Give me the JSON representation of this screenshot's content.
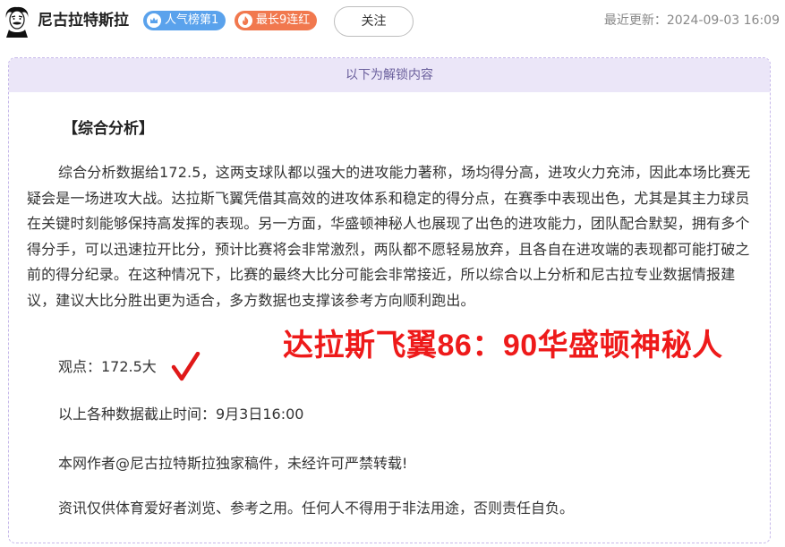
{
  "header": {
    "author_name": "尼古拉特斯拉",
    "avatar_icon": "einstein-portrait-avatar",
    "badges": [
      {
        "label": "人气榜第1",
        "icon": "crown-icon",
        "color": "#5aa2ec"
      },
      {
        "label": "最长9连红",
        "icon": "flame-icon",
        "color": "#f1784e"
      }
    ],
    "follow_label": "关注",
    "update_time": "最近更新：2024-09-03 16:09"
  },
  "card": {
    "banner": "以下为解锁内容",
    "section_title": "【综合分析】",
    "paragraph": "综合分析数据给172.5，这两支球队都以强大的进攻能力著称，场均得分高，进攻火力充沛，因此本场比赛无疑会是一场进攻大战。达拉斯飞翼凭借其高效的进攻体系和稳定的得分点，在赛季中表现出色，尤其是其主力球员在关键时刻能够保持高发挥的表现。另一方面，华盛顿神秘人也展现了出色的进攻能力，团队配合默契，拥有多个得分手，可以迅速拉开比分，预计比赛将会非常激烈，两队都不愿轻易放弃，且各自在进攻端的表现都可能打破之前的得分纪录。在这种情况下，比赛的最终大比分可能会非常接近，所以综合以上分析和尼古拉专业数据情报建议，建议大比分胜出更为适合，多方数据也支撑该参考方向顺利跑出。",
    "viewpoint": "观点：172.5大",
    "viewpoint_mark": "red-check-icon",
    "cutoff": "以上各种数据截止时间：9月3日16:00",
    "copyright": "本网作者@尼古拉特斯拉独家稿件，未经许可严禁转载!",
    "disclaimer": "资讯仅供体育爱好者浏览、参考之用。任何人不得用于非法用途，否则责任自负。",
    "score_overlay": "达拉斯飞翼86：90华盛顿神秘人"
  }
}
